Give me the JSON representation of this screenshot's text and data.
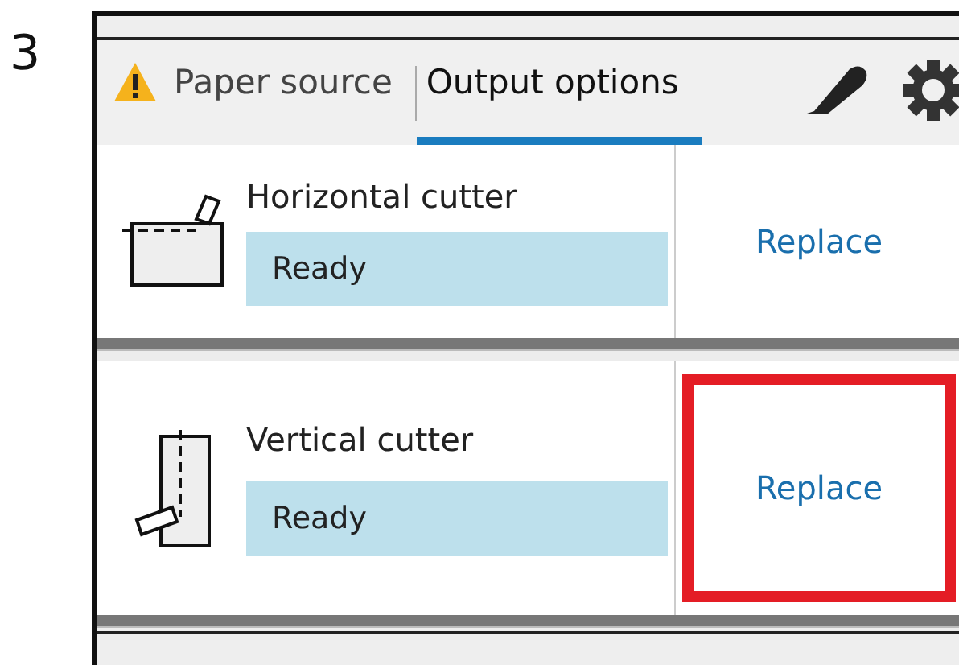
{
  "step": "3",
  "tabs": [
    {
      "label": "Paper source",
      "warning": true,
      "selected": false
    },
    {
      "label": "Output options",
      "warning": false,
      "selected": true
    }
  ],
  "cutters": [
    {
      "kind": "horizontal",
      "name": "Horizontal cutter",
      "status": "Ready",
      "action": "Replace",
      "highlighted": false
    },
    {
      "kind": "vertical",
      "name": "Vertical cutter",
      "status": "Ready",
      "action": "Replace",
      "highlighted": true
    }
  ]
}
